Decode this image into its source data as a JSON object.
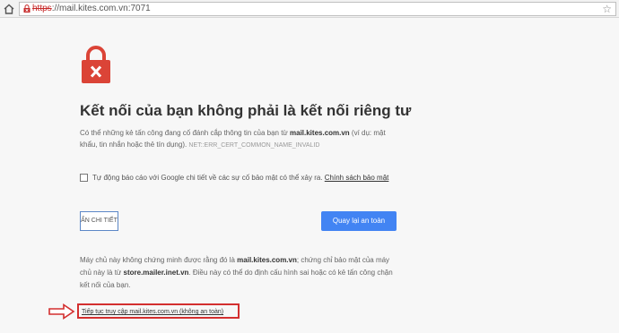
{
  "browser": {
    "url_scheme": "https",
    "url_rest": "://mail.kites.com.vn:7071"
  },
  "page": {
    "heading": "Kết nối của bạn không phải là kết nối riêng tư",
    "description_before": "Có thể những kẻ tấn công đang cố đánh cắp thông tin của bạn từ ",
    "description_domain": "mail.kites.com.vn",
    "description_after": " (ví dụ: mật khẩu, tin nhắn hoặc thẻ tín dụng). ",
    "error_code": "NET::ERR_CERT_COMMON_NAME_INVALID",
    "report_text": "Tự động báo cáo với Google chi tiết về các sự cố bảo mật có thể xảy ra. ",
    "report_link": "Chính sách bảo mật",
    "details_button": "ẨN CHI TIẾT",
    "back_button": "Quay lại an toàn",
    "detail_before": "Máy chủ này không chứng minh được rằng đó là ",
    "detail_domain": "mail.kites.com.vn",
    "detail_middle": "; chứng chỉ bảo mật của máy chủ này là từ ",
    "detail_issuer": "store.mailer.inet.vn",
    "detail_after": ". Điều này có thể do định cấu hình sai hoặc có kẻ tấn công chặn kết nối của bạn.",
    "proceed_link": "Tiếp tục truy cập mail.kites.com.vn (không an toàn)"
  },
  "colors": {
    "warning_red": "#db4437",
    "accent_blue": "#4284f3",
    "annotation_red": "#d32f2f"
  },
  "icons": [
    "home-icon",
    "lock-x-icon",
    "star-icon",
    "warning-lock-icon",
    "arrow-annotation-icon"
  ]
}
